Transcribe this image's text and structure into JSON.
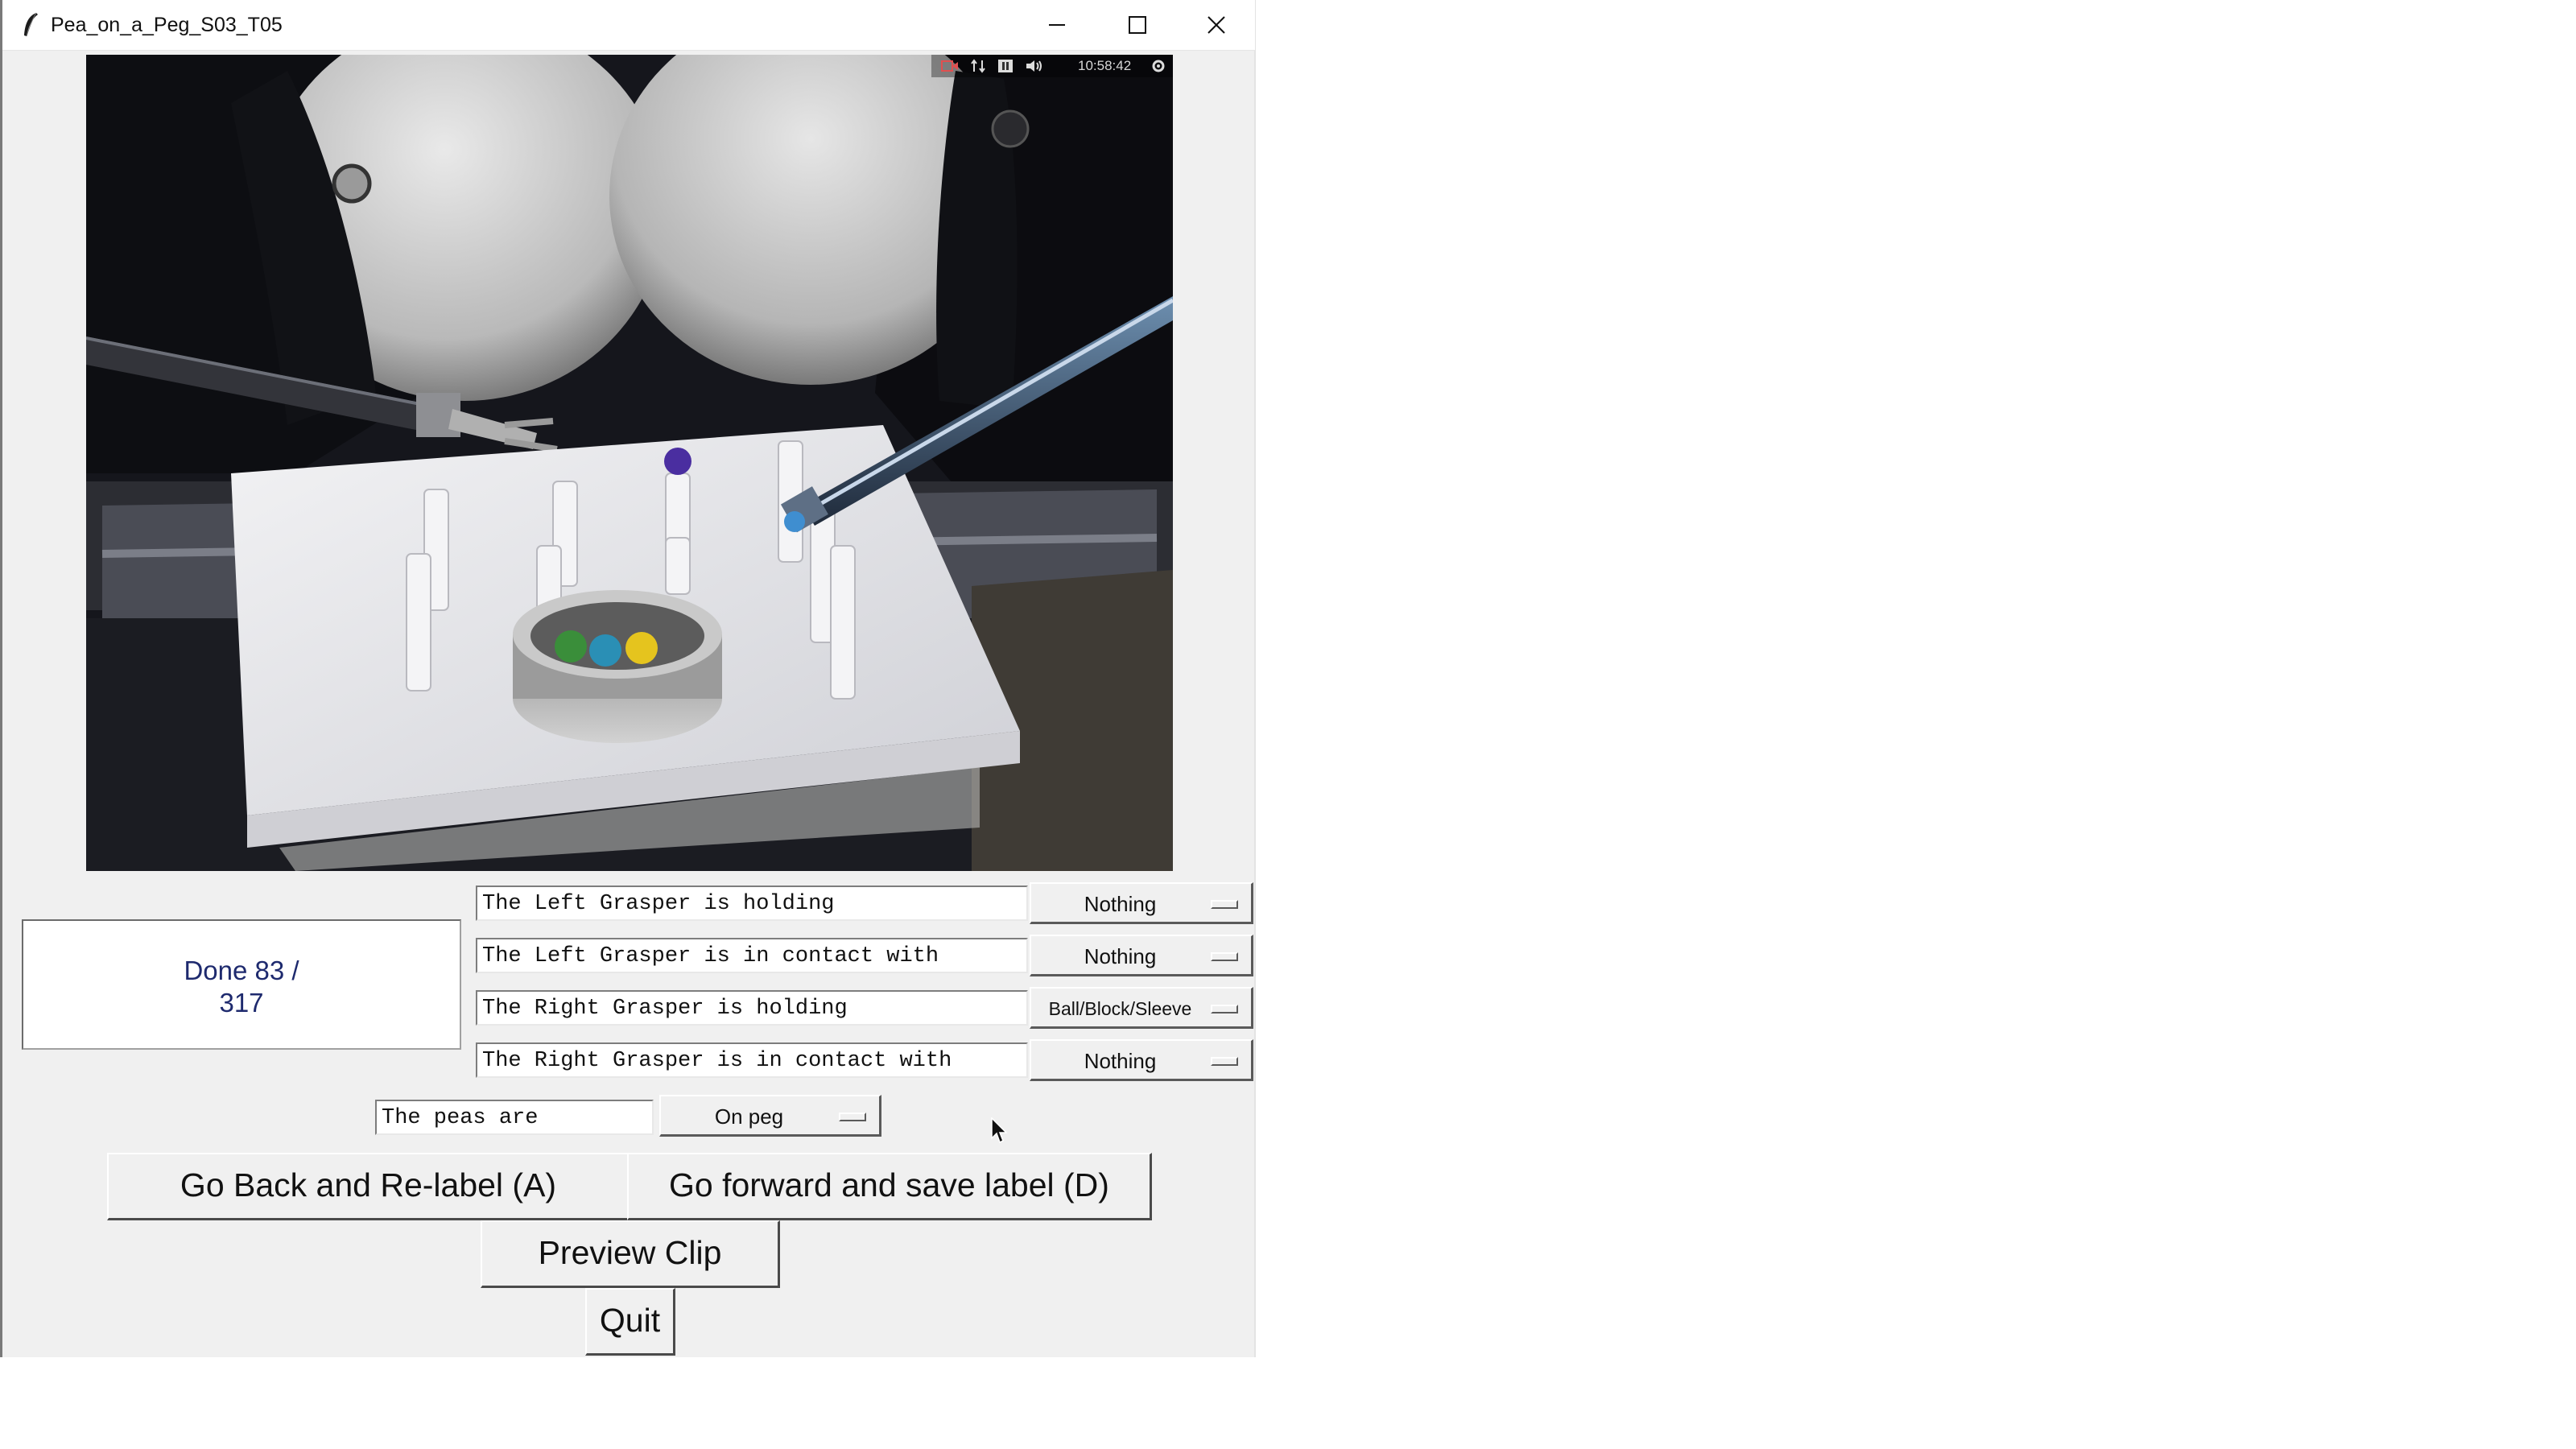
{
  "window": {
    "title": "Pea_on_a_Peg_S03_T05",
    "controls": {
      "minimize_icon": "minimize-icon",
      "maximize_icon": "maximize-icon",
      "close_icon": "close-icon"
    }
  },
  "video": {
    "overlay_time": "10:58:42",
    "overlay_icons": [
      "record-icon",
      "network-icon",
      "pause-icon",
      "volume-icon",
      "settings-icon"
    ]
  },
  "status": {
    "line1": "Done 83 /",
    "line2": "317"
  },
  "labels": [
    {
      "prompt": "The Left Grasper is holding",
      "value": "Nothing"
    },
    {
      "prompt": "The Left Grasper is in contact with",
      "value": "Nothing"
    },
    {
      "prompt": "The Right Grasper is holding",
      "value": "Ball/Block/Sleeve"
    },
    {
      "prompt": "The Right Grasper is in contact with",
      "value": "Nothing"
    }
  ],
  "peas": {
    "prompt": "The peas are",
    "value": "On peg"
  },
  "buttons": {
    "back": "Go Back and Re-label (A)",
    "forward": "Go forward and save label (D)",
    "preview": "Preview Clip",
    "quit": "Quit"
  }
}
